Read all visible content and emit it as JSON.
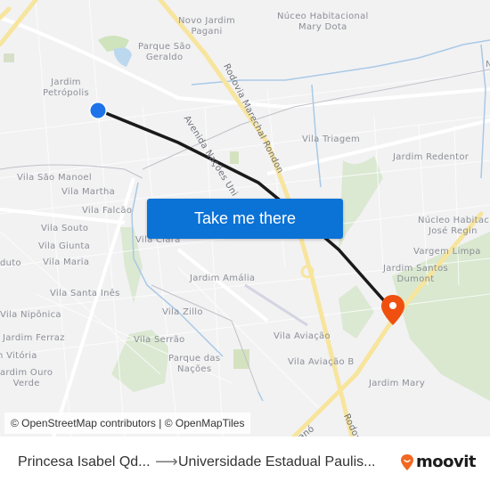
{
  "map": {
    "neighborhoods": [
      {
        "id": "novo-jardim-pagani",
        "lines": [
          "Novo Jardim",
          "Pagani"
        ]
      },
      {
        "id": "nucleo-mary-dota",
        "lines": [
          "Núceo Habitacional",
          "Mary Dota"
        ]
      },
      {
        "id": "parque-sao-geraldo",
        "lines": [
          "Parque São",
          "Geraldo"
        ]
      },
      {
        "id": "jardim-petropolis",
        "lines": [
          "Jardim",
          "Petrópolis"
        ]
      },
      {
        "id": "vila-triagem",
        "lines": [
          "Vila Triagem"
        ]
      },
      {
        "id": "jardim-redentor",
        "lines": [
          "Jardim Redentor"
        ]
      },
      {
        "id": "vila-sao-manoel",
        "lines": [
          "Vila São Manoel"
        ]
      },
      {
        "id": "vila-martha",
        "lines": [
          "Vila Martha"
        ]
      },
      {
        "id": "vila-falcao",
        "lines": [
          "Vila Falcão"
        ]
      },
      {
        "id": "nucleo-jose-regino",
        "lines": [
          "Núcleo Habitac",
          "José Regin"
        ]
      },
      {
        "id": "vila-souto",
        "lines": [
          "Vila Souto"
        ]
      },
      {
        "id": "vila-clara",
        "lines": [
          "Vila Clara"
        ]
      },
      {
        "id": "vargem-limpa",
        "lines": [
          "Vargem Limpa"
        ]
      },
      {
        "id": "vila-giunta",
        "lines": [
          "Vila Giunta"
        ]
      },
      {
        "id": "duto",
        "lines": [
          "duto"
        ]
      },
      {
        "id": "vila-maria",
        "lines": [
          "Vila Maria"
        ]
      },
      {
        "id": "jardim-santos-dumont",
        "lines": [
          "Jardim Santos",
          "Dumont"
        ]
      },
      {
        "id": "jardim-amalia",
        "lines": [
          "Jardim Amália"
        ]
      },
      {
        "id": "vila-santa-ines",
        "lines": [
          "Vila Santa Inês"
        ]
      },
      {
        "id": "vila-niponica",
        "lines": [
          "Vila Nipônica"
        ]
      },
      {
        "id": "vila-zillo",
        "lines": [
          "Vila Zillo"
        ]
      },
      {
        "id": "jardim-ferraz",
        "lines": [
          "Jardim Ferraz"
        ]
      },
      {
        "id": "vila-serrao",
        "lines": [
          "Vila Serrão"
        ]
      },
      {
        "id": "vila-aviacao",
        "lines": [
          "Vila Aviação"
        ]
      },
      {
        "id": "vitoria",
        "lines": [
          "n Vitória"
        ]
      },
      {
        "id": "parque-das-nacoes",
        "lines": [
          "Parque das",
          "Nações"
        ]
      },
      {
        "id": "vila-aviacao-b",
        "lines": [
          "Vila Aviação B"
        ]
      },
      {
        "id": "jardim-ouro-verde",
        "lines": [
          "ardim Ouro",
          "Verde"
        ]
      },
      {
        "id": "jardim-mary",
        "lines": [
          "Jardim Mary"
        ]
      },
      {
        "id": "n-edge",
        "lines": [
          "N"
        ]
      }
    ],
    "roads": {
      "rodovia_marechal_rondon": "Rodovia Marechal Rondon",
      "avenida_nacoes_unidas": "Avenida Nações Uni",
      "rodovia_bottom": "Rodov",
      "road_ano": "anó"
    },
    "origin_marker_color": "#1e73e8",
    "destination_marker_color": "#f0500f",
    "route_color": "#1a1a1a"
  },
  "cta": {
    "label": "Take me there"
  },
  "attribution": "© OpenStreetMap contributors | © OpenMapTiles",
  "footer": {
    "from": "Princesa Isabel Qd...",
    "arrow": "⟶",
    "to": "Universidade Estadual Paulis...",
    "brand": "moovit",
    "brand_color": "#f2671f"
  }
}
